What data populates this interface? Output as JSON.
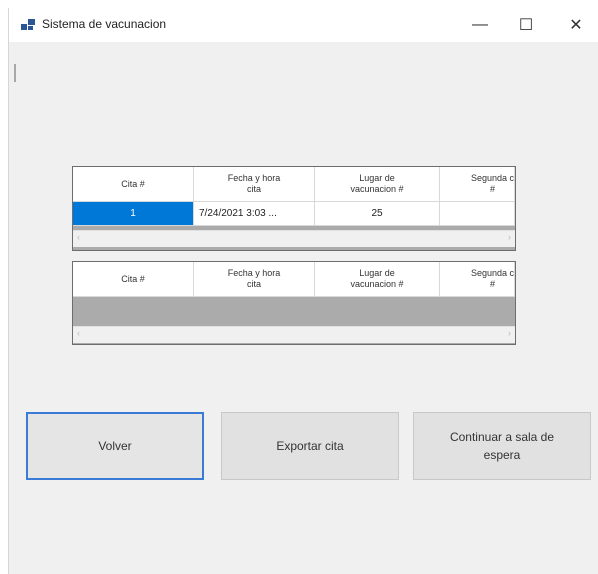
{
  "window": {
    "title": "Sistema de vacunacion",
    "controls": {
      "minimize": "—",
      "maximize": "☐",
      "close": "✕"
    }
  },
  "grid1": {
    "columns": [
      "Cita #",
      "Fecha y hora\ncita",
      "Lugar de\nvacunacion #",
      "Segunda c\n#"
    ],
    "rows": [
      {
        "cita": "1",
        "fecha": "7/24/2021 3:03 ...",
        "lugar": "25",
        "segunda": ""
      }
    ],
    "scroll_left": "‹",
    "scroll_right": "›"
  },
  "grid2": {
    "columns": [
      "Cita #",
      "Fecha y hora\ncita",
      "Lugar de\nvacunacion #",
      "Segunda c\n#"
    ],
    "scroll_left": "‹",
    "scroll_right": "›"
  },
  "buttons": {
    "volver": "Volver",
    "exportar": "Exportar cita",
    "continuar": "Continuar a sala de\nespera"
  },
  "colors": {
    "selection": "#0078d7",
    "grid_bg": "#ababab",
    "form_bg": "#f0f0f0"
  },
  "icons": {
    "app": "app-icon"
  }
}
